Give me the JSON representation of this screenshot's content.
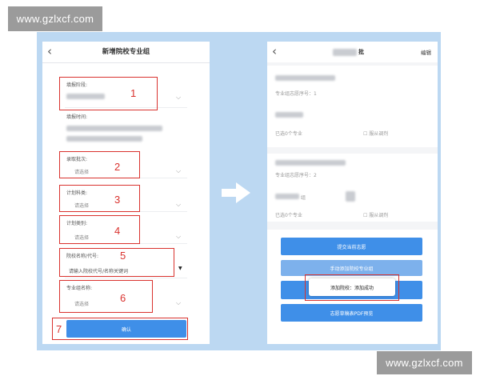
{
  "watermark": {
    "top": "www.gzlxcf.com",
    "bottom": "www.gzlxcf.com"
  },
  "left_screen": {
    "title": "新增院校专业组",
    "back_icon": "‹",
    "fields": {
      "fill_stage_label": "填报阶段:",
      "fill_time_label": "填报时间:",
      "batch_label": "录取批次:",
      "batch_value": "请选择",
      "plan_subject_label": "计划科类:",
      "plan_subject_value": "请选择",
      "plan_type_label": "计划类别:",
      "plan_type_value": "请选择",
      "school_label": "院校名称/代号:",
      "school_placeholder": "请输入院校代号/名称关键词",
      "group_label": "专业组名称:",
      "group_value": "请选择"
    },
    "confirm_button": "确认",
    "step_numbers": [
      "1",
      "2",
      "3",
      "4",
      "5",
      "6",
      "7"
    ]
  },
  "right_screen": {
    "back_icon": "‹",
    "title_suffix": "批",
    "edit": "编辑",
    "card1": {
      "order": "专业组志愿序号：1",
      "selected": "已选0个专业",
      "obey": "服从调剂"
    },
    "card2": {
      "order": "专业组志愿序号：2",
      "suffix": "组",
      "selected": "已选0个专业",
      "obey": "服从调剂"
    },
    "buttons": {
      "submit": "提交当前志愿",
      "manual_add": "手动添加院校专业组",
      "toast": "添加院校：添加成功",
      "pdf": "志愿草稿表PDF预览"
    }
  },
  "colors": {
    "frame": "#bcd8f2",
    "accent_blue": "#3f8fe8",
    "annotation_red": "#d9322e"
  }
}
